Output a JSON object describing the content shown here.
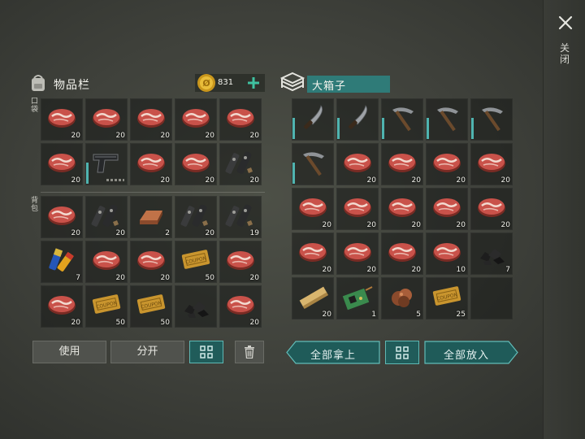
{
  "header": {
    "inventory_title": "物品栏",
    "coins": "831",
    "chest_title": "大箱子",
    "close_label": "关闭",
    "pocket_tag": "口袋",
    "backpack_tag": "背包"
  },
  "pocket": [
    {
      "item": "steak",
      "qty": "20"
    },
    {
      "item": "steak",
      "qty": "20"
    },
    {
      "item": "steak",
      "qty": "20"
    },
    {
      "item": "steak",
      "qty": "20"
    },
    {
      "item": "steak",
      "qty": "20"
    },
    {
      "item": "steak",
      "qty": "20"
    },
    {
      "item": "pistol",
      "qty": "",
      "durability": true,
      "ammo_dots": true
    },
    {
      "item": "steak",
      "qty": "20"
    },
    {
      "item": "steak",
      "qty": "20"
    },
    {
      "item": "gun-parts",
      "qty": "20"
    }
  ],
  "backpack": [
    {
      "item": "steak",
      "qty": "20"
    },
    {
      "item": "gun-parts",
      "qty": "20"
    },
    {
      "item": "copper-ingot",
      "qty": "2"
    },
    {
      "item": "gun-parts",
      "qty": "20"
    },
    {
      "item": "gun-parts",
      "qty": "19"
    },
    {
      "item": "batteries",
      "qty": "7"
    },
    {
      "item": "steak",
      "qty": "20"
    },
    {
      "item": "steak",
      "qty": "20"
    },
    {
      "item": "coupon",
      "qty": "50"
    },
    {
      "item": "steak",
      "qty": "20"
    },
    {
      "item": "steak",
      "qty": "20"
    },
    {
      "item": "coupon",
      "qty": "50"
    },
    {
      "item": "coupon",
      "qty": "50"
    },
    {
      "item": "coal",
      "qty": ""
    },
    {
      "item": "steak",
      "qty": "20"
    }
  ],
  "chest": [
    {
      "item": "machete",
      "qty": "",
      "durability": true
    },
    {
      "item": "machete",
      "qty": "",
      "durability": true
    },
    {
      "item": "pickaxe",
      "qty": "",
      "durability": true
    },
    {
      "item": "pickaxe",
      "qty": "",
      "durability": true
    },
    {
      "item": "pickaxe",
      "qty": "",
      "durability": true
    },
    {
      "item": "pickaxe",
      "qty": "",
      "durability": true
    },
    {
      "item": "steak",
      "qty": "20"
    },
    {
      "item": "steak",
      "qty": "20"
    },
    {
      "item": "steak",
      "qty": "20"
    },
    {
      "item": "steak",
      "qty": "20"
    },
    {
      "item": "steak",
      "qty": "20"
    },
    {
      "item": "steak",
      "qty": "20"
    },
    {
      "item": "steak",
      "qty": "20"
    },
    {
      "item": "steak",
      "qty": "20"
    },
    {
      "item": "steak",
      "qty": "20"
    },
    {
      "item": "steak",
      "qty": "20"
    },
    {
      "item": "steak",
      "qty": "20"
    },
    {
      "item": "steak",
      "qty": "20"
    },
    {
      "item": "steak",
      "qty": "10"
    },
    {
      "item": "coal",
      "qty": "7"
    },
    {
      "item": "plank",
      "qty": "20"
    },
    {
      "item": "circuit-board",
      "qty": "1"
    },
    {
      "item": "copper-ore",
      "qty": "5"
    },
    {
      "item": "coupon",
      "qty": "25"
    },
    {
      "item": "empty",
      "qty": ""
    }
  ],
  "buttons": {
    "use": "使用",
    "split": "分开",
    "take_all": "全部拿上",
    "put_all": "全部放入"
  },
  "colors": {
    "accent_teal": "#2f7b78",
    "durability": "#4fb4b0"
  }
}
